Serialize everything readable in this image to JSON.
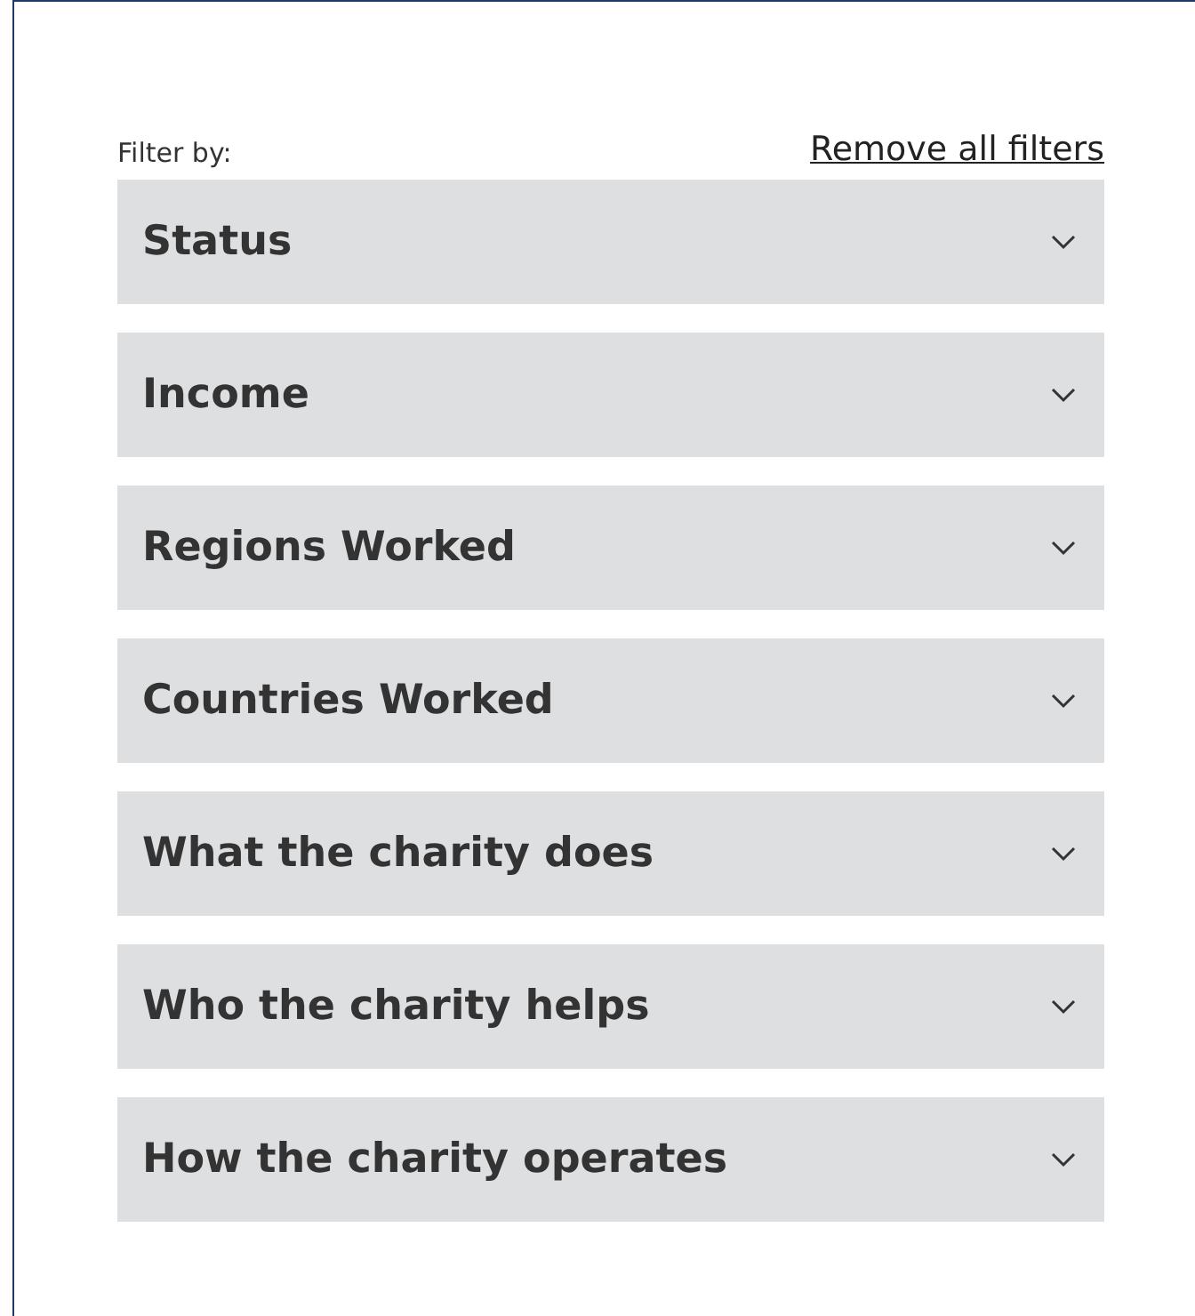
{
  "filter_label": "Filter by:",
  "remove_link": "Remove all filters",
  "filters": [
    {
      "label": "Status",
      "expanded": false
    },
    {
      "label": "Income",
      "expanded": false
    },
    {
      "label": "Regions Worked",
      "expanded": false
    },
    {
      "label": "Countries Worked",
      "expanded": false
    },
    {
      "label": "What the charity does",
      "expanded": false
    },
    {
      "label": "Who the charity helps",
      "expanded": false
    },
    {
      "label": "How the charity operates",
      "expanded": false
    }
  ]
}
